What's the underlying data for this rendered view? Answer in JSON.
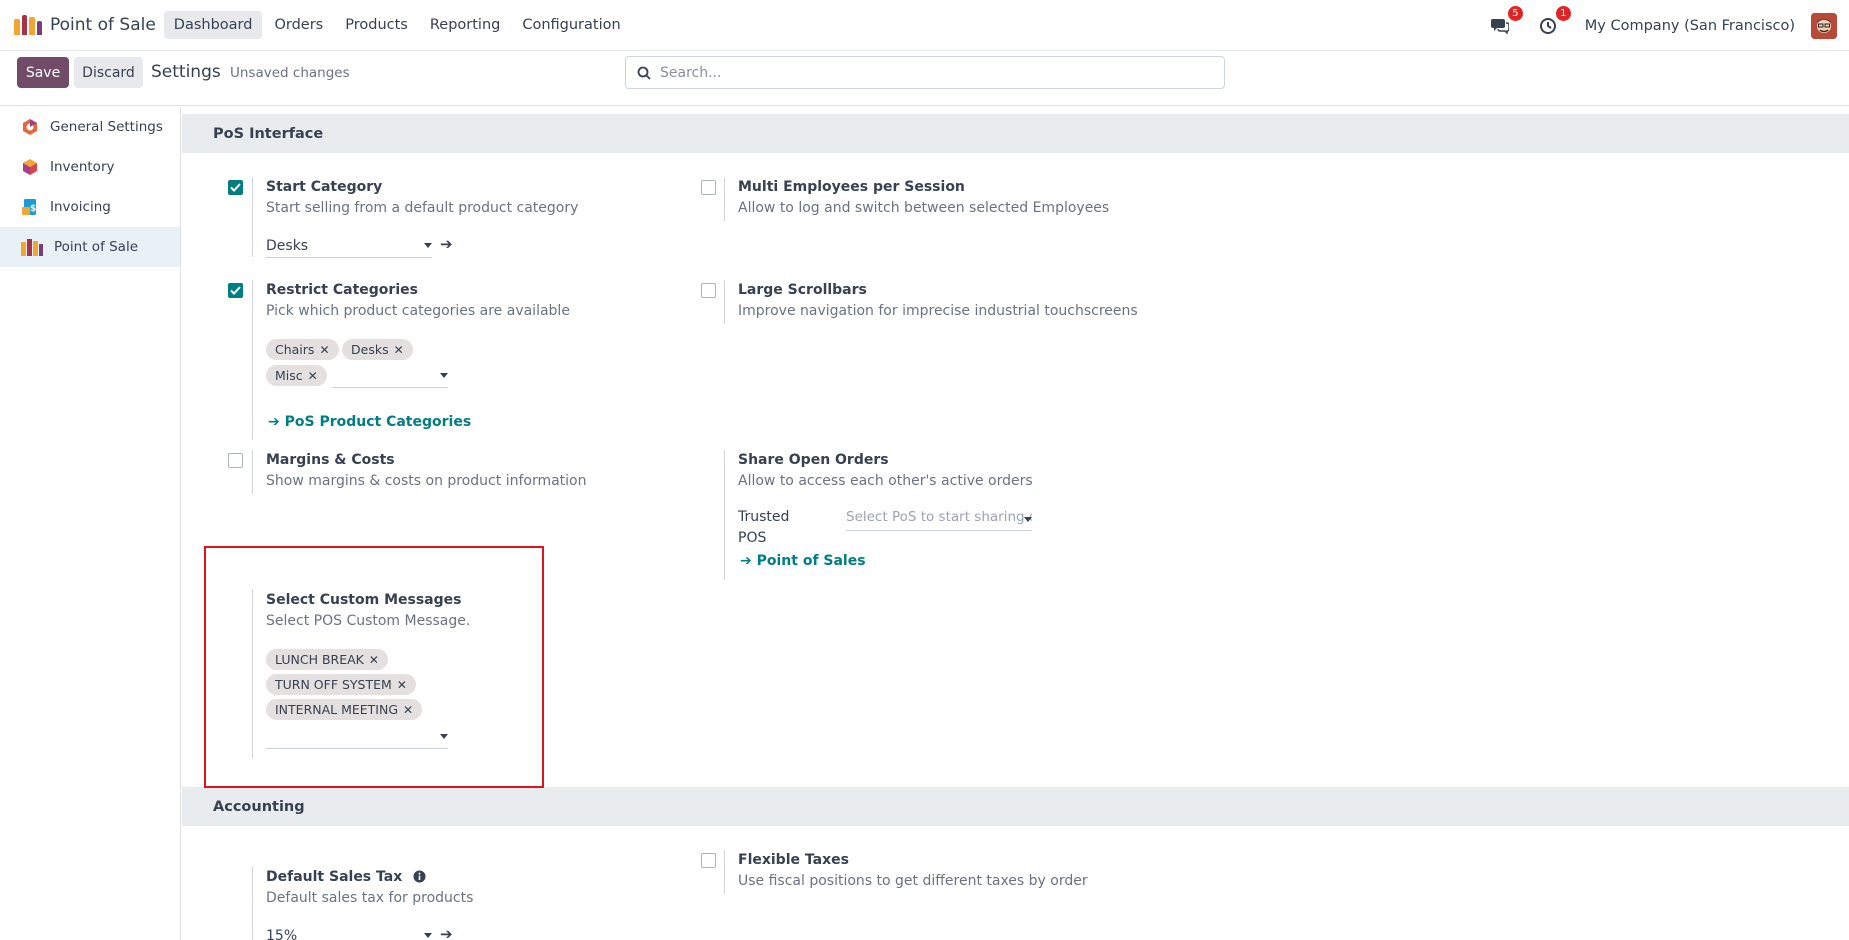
{
  "navbar": {
    "app_title": "Point of Sale",
    "menu": [
      "Dashboard",
      "Orders",
      "Products",
      "Reporting",
      "Configuration"
    ],
    "active_menu": "Dashboard",
    "messages_count": "5",
    "activities_count": "1",
    "company": "My Company (San Francisco)"
  },
  "control": {
    "save_label": "Save",
    "discard_label": "Discard",
    "title": "Settings",
    "status": "Unsaved changes",
    "search_placeholder": "Search..."
  },
  "sidebar": {
    "items": [
      {
        "label": "General Settings",
        "icon": "general-settings-icon"
      },
      {
        "label": "Inventory",
        "icon": "inventory-icon"
      },
      {
        "label": "Invoicing",
        "icon": "invoicing-icon"
      },
      {
        "label": "Point of Sale",
        "icon": "point-of-sale-icon",
        "active": true
      }
    ]
  },
  "sections": {
    "pos_interface": {
      "title": "PoS Interface",
      "start_category": {
        "title": "Start Category",
        "desc": "Start selling from a default product category",
        "checked": true,
        "value": "Desks"
      },
      "multi_employees": {
        "title": "Multi Employees per Session",
        "desc": "Allow to log and switch between selected Employees",
        "checked": false
      },
      "restrict_categories": {
        "title": "Restrict Categories",
        "desc": "Pick which product categories are available",
        "checked": true,
        "tags": [
          "Chairs",
          "Desks",
          "Misc"
        ],
        "link": "PoS Product Categories"
      },
      "large_scrollbars": {
        "title": "Large Scrollbars",
        "desc": "Improve navigation for imprecise industrial touchscreens",
        "checked": false
      },
      "margins_costs": {
        "title": "Margins & Costs",
        "desc": "Show margins & costs on product information",
        "checked": false
      },
      "share_open_orders": {
        "title": "Share Open Orders",
        "desc": "Allow to access each other's active orders",
        "trusted_label_1": "Trusted",
        "trusted_label_2": "POS",
        "trusted_placeholder": "Select PoS to start sharing orders",
        "link": "Point of Sales"
      },
      "custom_messages": {
        "title": "Select Custom Messages",
        "desc": "Select POS Custom Message.",
        "tags": [
          "LUNCH BREAK",
          "TURN OFF SYSTEM",
          "INTERNAL MEETING"
        ]
      }
    },
    "accounting": {
      "title": "Accounting",
      "default_sales_tax": {
        "title": "Default Sales Tax",
        "desc": "Default sales tax for products",
        "value": "15%"
      },
      "flexible_taxes": {
        "title": "Flexible Taxes",
        "desc": "Use fiscal positions to get different taxes by order",
        "checked": false
      }
    }
  },
  "colors": {
    "brand": "#714b67",
    "accent": "#017e84",
    "highlight": "#e0141e"
  }
}
